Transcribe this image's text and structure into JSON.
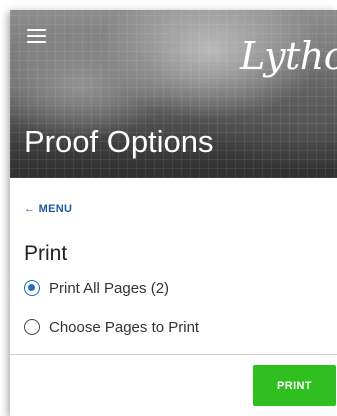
{
  "header": {
    "logo_text": "Lytho",
    "title": "Proof Options"
  },
  "nav": {
    "back_label": "← MENU"
  },
  "print_section": {
    "title": "Print",
    "options": [
      {
        "label": "Print All Pages (2)",
        "selected": true
      },
      {
        "label": "Choose Pages to Print",
        "selected": false
      }
    ]
  },
  "footer": {
    "print_button_label": "PRINT"
  },
  "colors": {
    "accent_blue": "#1e5aa0",
    "print_button_green": "#2fbf1f"
  },
  "icons": {
    "menu": "hamburger-menu-icon"
  }
}
